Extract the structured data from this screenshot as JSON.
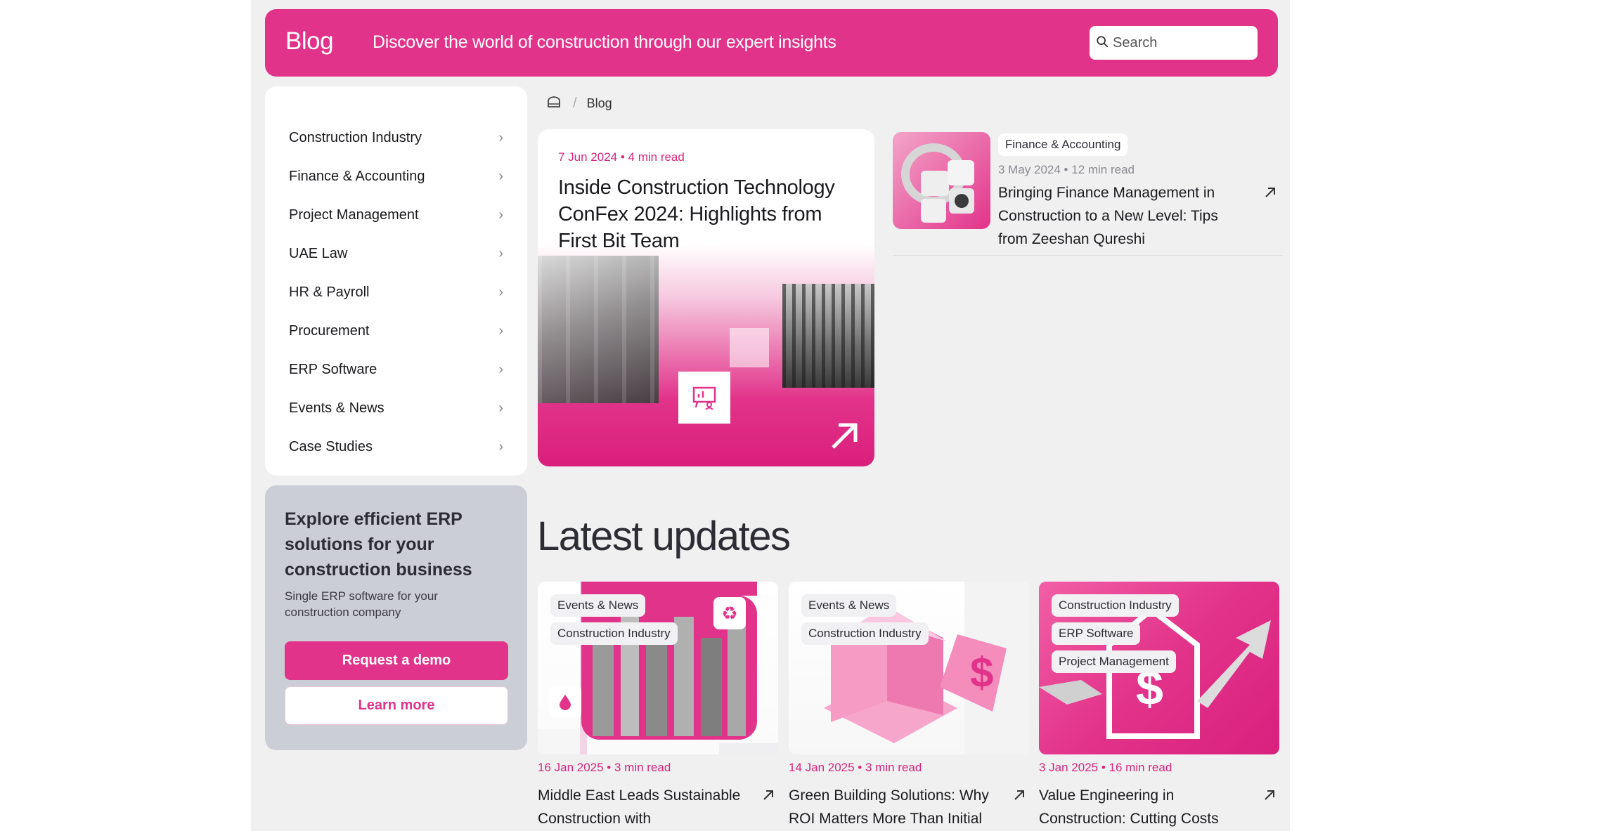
{
  "header": {
    "brand": "Blog",
    "tagline": "Discover the world of construction through our expert insights",
    "search_placeholder": "Search"
  },
  "sidebar": {
    "items": [
      {
        "label": "Construction Industry"
      },
      {
        "label": "Finance & Accounting"
      },
      {
        "label": "Project Management"
      },
      {
        "label": "UAE Law"
      },
      {
        "label": "HR & Payroll"
      },
      {
        "label": "Procurement"
      },
      {
        "label": "ERP Software"
      },
      {
        "label": "Events & News"
      },
      {
        "label": "Case Studies"
      }
    ]
  },
  "promo": {
    "title": "Explore efficient ERP solutions for your construction business",
    "subtitle": "Single ERP software for your construction company",
    "primary_label": "Request a demo",
    "secondary_label": "Learn more"
  },
  "breadcrumb": {
    "current": "Blog"
  },
  "featured": {
    "meta": "7 Jun 2024 • 4 min read",
    "title": "Inside Construction Technology ConFex 2024: Highlights from First Bit Team"
  },
  "side_article": {
    "tag": "Finance & Accounting",
    "meta": "3 May 2024 • 12 min read",
    "title": "Bringing Finance Management in Construction to a New Level: Tips from Zeeshan Qureshi"
  },
  "latest": {
    "heading": "Latest updates",
    "cards": [
      {
        "tags": [
          "Events & News",
          "Construction Industry"
        ],
        "meta": "16 Jan 2025 • 3 min read",
        "title": "Middle East Leads Sustainable Construction with"
      },
      {
        "tags": [
          "Events & News",
          "Construction Industry"
        ],
        "meta": "14 Jan 2025 • 3 min read",
        "title": "Green Building Solutions: Why ROI Matters More Than Initial"
      },
      {
        "tags": [
          "Construction Industry",
          "ERP Software",
          "Project Management"
        ],
        "meta": "3 Jan 2025 • 16 min read",
        "title": "Value Engineering in Construction: Cutting Costs"
      }
    ]
  },
  "colors": {
    "accent": "#e2338a",
    "page_bg": "#f0f0f1",
    "promo_bg": "#ccced5"
  },
  "icons": [
    "search-icon",
    "home-icon",
    "chevron-right-icon",
    "arrow-up-right-icon",
    "presentation-icon",
    "recycle-icon",
    "drop-icon"
  ]
}
